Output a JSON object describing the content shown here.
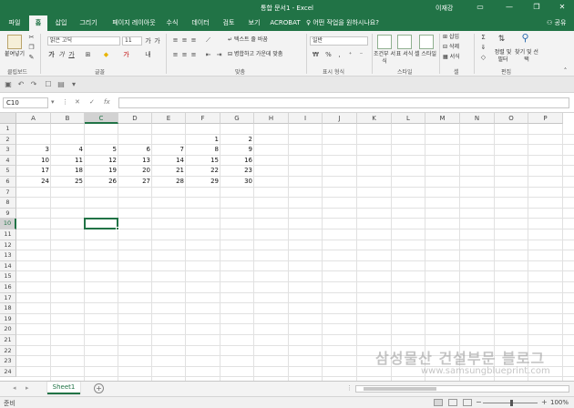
{
  "titlebar": {
    "title": "통합 문서1 - Excel",
    "user": "이재강",
    "minimize": "—",
    "restore": "❐",
    "close": "✕"
  },
  "tabs": [
    {
      "label": "파일",
      "active": false
    },
    {
      "label": "홈",
      "active": true
    },
    {
      "label": "삽입",
      "active": false
    },
    {
      "label": "그리기",
      "active": false
    },
    {
      "label": "페이지 레이아웃",
      "active": false
    },
    {
      "label": "수식",
      "active": false
    },
    {
      "label": "데이터",
      "active": false
    },
    {
      "label": "검토",
      "active": false
    },
    {
      "label": "보기",
      "active": false
    },
    {
      "label": "ACROBAT",
      "active": false
    }
  ],
  "tellme": "어떤 작업을 원하시나요?",
  "share": "공유",
  "ribbon": {
    "paste_label": "붙여넣기",
    "font_name": "맑은 고딕",
    "font_size": "11",
    "wrap_text": "텍스트 줄 바꿈",
    "merge_center": "병합하고 가운데 맞춤",
    "number_format": "일반",
    "cond_format": "조건부 서식",
    "table_format": "표 서식",
    "cell_style": "셀 스타일",
    "insert": "삽입",
    "delete": "삭제",
    "format": "서식",
    "sort_filter": "정렬 및 필터",
    "find_select": "찾기 및 선택",
    "groups": {
      "clipboard": "클립보드",
      "font": "글꼴",
      "align": "맞춤",
      "number": "표시 형식",
      "style": "스타일",
      "cells": "셀",
      "edit": "편집"
    }
  },
  "formula": {
    "namebox": "C10",
    "fx": "fx",
    "value": ""
  },
  "grid": {
    "columns": [
      "A",
      "B",
      "C",
      "D",
      "E",
      "F",
      "G",
      "H",
      "I",
      "J",
      "K",
      "L",
      "M",
      "N",
      "O",
      "P"
    ],
    "rows": [
      "1",
      "2",
      "3",
      "4",
      "5",
      "6",
      "7",
      "8",
      "9",
      "10",
      "11",
      "12",
      "13",
      "14",
      "15",
      "16",
      "17",
      "18",
      "19",
      "20",
      "21",
      "22",
      "23",
      "24"
    ],
    "selected_col": "C",
    "selected_row": "10",
    "cells": [
      [
        "",
        "",
        "",
        "",
        "",
        "",
        ""
      ],
      [
        "",
        "",
        "",
        "",
        "",
        "1",
        "2"
      ],
      [
        "3",
        "4",
        "5",
        "6",
        "7",
        "8",
        "9"
      ],
      [
        "10",
        "11",
        "12",
        "13",
        "14",
        "15",
        "16"
      ],
      [
        "17",
        "18",
        "19",
        "20",
        "21",
        "22",
        "23"
      ],
      [
        "24",
        "25",
        "26",
        "27",
        "28",
        "29",
        "30"
      ]
    ]
  },
  "watermark": {
    "title": "삼성물산 건설부문 블로그",
    "url": "www.samsungblueprint.com"
  },
  "sheets": {
    "active": "Sheet1",
    "add": "+"
  },
  "status": {
    "ready": "준비",
    "zoom": "100%"
  }
}
